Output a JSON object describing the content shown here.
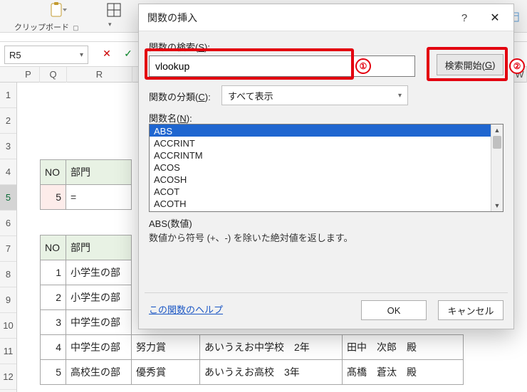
{
  "ribbon": {
    "clipboard_label": "クリップボード",
    "clipboard_suffix": "⏷"
  },
  "namebox": {
    "value": "R5"
  },
  "columns": {
    "P": "P",
    "Q": "Q",
    "R": "R",
    "W": "W"
  },
  "rows": [
    "1",
    "2",
    "3",
    "4",
    "5",
    "6",
    "7",
    "8",
    "9",
    "10",
    "11",
    "12"
  ],
  "upper_table": {
    "headers": [
      "NO",
      "部門"
    ],
    "row": {
      "no": "5",
      "formula": "="
    }
  },
  "lower_table": {
    "headers": [
      "NO",
      "部門"
    ],
    "rows": [
      {
        "no": "1",
        "dept": "小学生の部"
      },
      {
        "no": "2",
        "dept": "小学生の部"
      },
      {
        "no": "3",
        "dept": "中学生の部"
      },
      {
        "no": "4",
        "dept": "中学生の部",
        "award": "努力賞",
        "school": "あいうえお中学校　2年",
        "name": "田中　次郎　殿"
      },
      {
        "no": "5",
        "dept": "高校生の部",
        "award": "優秀賞",
        "school": "あいうえお高校　3年",
        "name": "髙橋　蒼汰　殿"
      }
    ]
  },
  "dialog": {
    "title": "関数の挿入",
    "search_label_pre": "関数の検索(",
    "search_label_key": "S",
    "search_label_post": "):",
    "search_value": "vlookup",
    "go_pre": "検索開始(",
    "go_key": "G",
    "go_post": ")",
    "category_label_pre": "関数の分類(",
    "category_label_key": "C",
    "category_label_post": "):",
    "category_value": "すべて表示",
    "list_label_pre": "関数名(",
    "list_label_key": "N",
    "list_label_post": "):",
    "items": [
      "ABS",
      "ACCRINT",
      "ACCRINTM",
      "ACOS",
      "ACOSH",
      "ACOT",
      "ACOTH"
    ],
    "desc_title": "ABS(数値)",
    "desc_text": "数値から符号 (+、-) を除いた絶対値を返します。",
    "help_link": "この関数のヘルプ",
    "ok": "OK",
    "cancel": "キャンセル",
    "marker1": "①",
    "marker2": "②"
  }
}
